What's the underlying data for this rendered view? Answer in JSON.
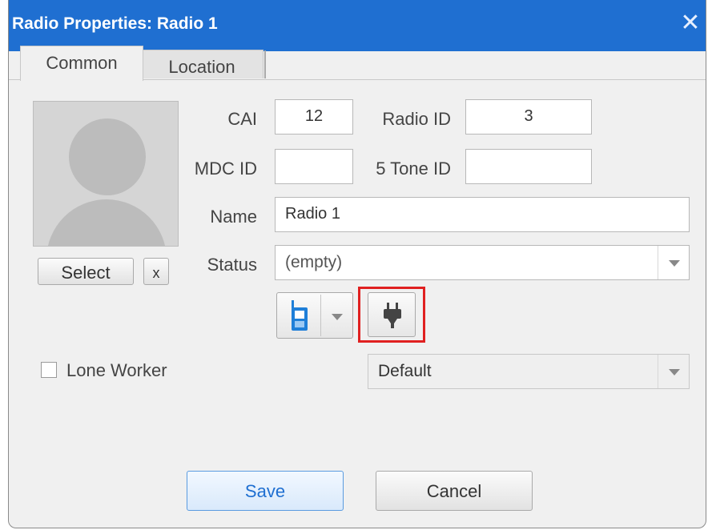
{
  "window": {
    "title": "Radio Properties: Radio 1",
    "close_glyph": "✕"
  },
  "tabs": [
    {
      "label": "Common",
      "active": true
    },
    {
      "label": "Location",
      "active": false
    }
  ],
  "avatar": {
    "icon": "person-silhouette-icon",
    "select_label": "Select",
    "clear_label": "x"
  },
  "form": {
    "cai_label": "CAI",
    "cai_value": "12",
    "radio_id_label": "Radio ID",
    "radio_id_value": "3",
    "mdc_id_label": "MDC ID",
    "mdc_id_value": "",
    "five_tone_label": "5 Tone ID",
    "five_tone_value": "",
    "name_label": "Name",
    "name_value": "Radio 1",
    "status_label": "Status",
    "status_value": "(empty)"
  },
  "device_icons": {
    "radio_icon": "handheld-radio-icon",
    "plug_icon": "power-plug-icon",
    "radio_color": "#1f7fd8",
    "highlight_color": "#e02020"
  },
  "lone_worker": {
    "label": "Lone Worker",
    "checked": false,
    "profile_value": "Default"
  },
  "buttons": {
    "save_label": "Save",
    "cancel_label": "Cancel"
  },
  "colors": {
    "title_bar": "#1f6fd1",
    "background": "#f0f0f0"
  }
}
